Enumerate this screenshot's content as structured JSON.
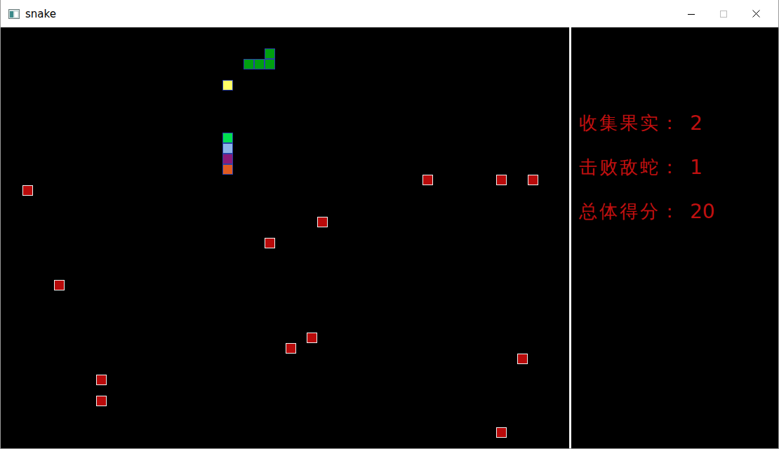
{
  "window": {
    "title": "snake"
  },
  "stats": [
    {
      "label": "收集果实：",
      "value": "2"
    },
    {
      "label": "击败敌蛇：",
      "value": "1"
    },
    {
      "label": "总体得分：",
      "value": "20"
    }
  ],
  "pieces": [
    {
      "kind": "fruit",
      "col": 2,
      "row": 15,
      "color": "#b80a0a"
    },
    {
      "kind": "fruit",
      "col": 5,
      "row": 24,
      "color": "#b80a0a"
    },
    {
      "kind": "fruit",
      "col": 9,
      "row": 33,
      "color": "#b80a0a"
    },
    {
      "kind": "fruit",
      "col": 9,
      "row": 35,
      "color": "#b80a0a"
    },
    {
      "kind": "fruit",
      "col": 25,
      "row": 20,
      "color": "#b80a0a"
    },
    {
      "kind": "fruit",
      "col": 30,
      "row": 18,
      "color": "#b80a0a"
    },
    {
      "kind": "fruit",
      "col": 27,
      "row": 30,
      "color": "#b80a0a"
    },
    {
      "kind": "fruit",
      "col": 29,
      "row": 29,
      "color": "#b80a0a"
    },
    {
      "kind": "fruit",
      "col": 40,
      "row": 14,
      "color": "#b80a0a"
    },
    {
      "kind": "fruit",
      "col": 47,
      "row": 14,
      "color": "#b80a0a"
    },
    {
      "kind": "fruit",
      "col": 50,
      "row": 14,
      "color": "#b80a0a"
    },
    {
      "kind": "fruit",
      "col": 49,
      "row": 31,
      "color": "#b80a0a"
    },
    {
      "kind": "fruit",
      "col": 47,
      "row": 38,
      "color": "#b80a0a"
    },
    {
      "kind": "enemy",
      "col": 25,
      "row": 2,
      "color": "#00a010"
    },
    {
      "kind": "enemy",
      "col": 23,
      "row": 3,
      "color": "#00a010"
    },
    {
      "kind": "enemy",
      "col": 24,
      "row": 3,
      "color": "#00a010"
    },
    {
      "kind": "enemy",
      "col": 25,
      "row": 3,
      "color": "#00a010"
    },
    {
      "kind": "bonus",
      "col": 21,
      "row": 5,
      "color": "#ffff66"
    },
    {
      "kind": "player",
      "col": 21,
      "row": 10,
      "color": "#00e050"
    },
    {
      "kind": "player",
      "col": 21,
      "row": 11,
      "color": "#8cb4e8"
    },
    {
      "kind": "player",
      "col": 21,
      "row": 12,
      "color": "#8a1a7a"
    },
    {
      "kind": "player",
      "col": 21,
      "row": 13,
      "color": "#e05a20"
    }
  ]
}
